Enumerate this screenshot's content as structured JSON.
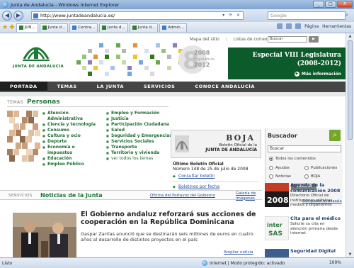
{
  "window": {
    "title": "Junta de Andalucía - Windows Internet Explorer",
    "buttons": {
      "minimize": "_",
      "maximize": "□",
      "close": "X"
    }
  },
  "browser": {
    "url": "http://www.juntadeandalucia.es/",
    "search_placeholder": "Google",
    "tabs": [
      "JUN...",
      "Junta d...",
      "Centra...",
      "Junta d...",
      "Junta d...",
      "Admin..."
    ],
    "tools": {
      "page": "Página",
      "tools": "Herramientas"
    }
  },
  "statusbar": {
    "left": "Listo",
    "zone": "Internet | Modo protegido: activado",
    "zoom": "100%"
  },
  "site": {
    "logo_text": "JUNTA DE ANDALUCIA",
    "toplinks": [
      "Mapa del sitio",
      "Listas de correo"
    ],
    "search_value": "Buscar",
    "banner": {
      "line1": "Especial VIII Legislatura",
      "line2": "(2008-2012)",
      "more": "Más información"
    },
    "legislatura_badge": {
      "year1": "2008",
      "word": "legislatura",
      "year2": "2012",
      "num": "8"
    },
    "nav": [
      "PORTADA",
      "TEMAS",
      "LA JUNTA",
      "SERVICIOS",
      "CONOCE ANDALUCÍA"
    ]
  },
  "temas": {
    "label": "TEMAS",
    "title": "Personas",
    "col1": [
      "Atención Administrativa",
      "Ciencia y tecnología",
      "Consumo",
      "Cultura y ocio",
      "Deporte",
      "Economía e impuestos",
      "Educación",
      "Empleo Público"
    ],
    "col2": [
      "Empleo y Formación",
      "Justicia",
      "Participación Ciudadana",
      "Salud",
      "Seguridad y Emergencias",
      "Servicios Sociales",
      "Transporte",
      "Territorio y vivienda",
      "ver todos los temas"
    ]
  },
  "boja": {
    "word": "BOJA",
    "sub1": "Boletín Oficial de la",
    "sub2": "JUNTA DE ANDALUCÍA",
    "last_title": "Último Boletín Oficial",
    "last_detail": "Número 148 de 25 de julio de 2008",
    "link1": "Consultar boletín",
    "link2": "Boletines por fecha"
  },
  "buscador": {
    "title": "Buscador",
    "input": "Buscar",
    "options": [
      "Todos los contenidos",
      "Ayudas",
      "Publicaciones",
      "Noticias",
      "BOJA"
    ],
    "button": "BUSCAR",
    "advanced": "Búsqueda avanzada"
  },
  "noticias": {
    "label": "SERVICIOS",
    "title": "Noticias de la Junta",
    "link1": "Oficina del Portavoz del Gobierno",
    "link2a": "Galería de",
    "link2b": "imágenes",
    "headline": "El Gobierno andaluz reforzará sus acciones de cooperación en la República Dominicana",
    "body": "Gaspar Zarrías anunció que se destinarán seis millones de euros en cuatro años al desarrollo de distintos proyectos en el país",
    "more": "Ampliar noticia"
  },
  "promos": [
    {
      "title": "Agenda de la comunicación 2008",
      "desc": "Directorio Oficial de instituciones públicas, medios y organismos",
      "badge": "2008"
    },
    {
      "title": "Cita para el médico",
      "desc": "Solicite su cita en atención primaria desde internet.",
      "badge": "inter SAS"
    },
    {
      "title": "Seguridad Digital",
      "desc": "",
      "badge": ""
    }
  ],
  "colors": {
    "brand_green": "#1f7a37",
    "banner_green": "#0c5c2b",
    "nav_dark": "#454545"
  }
}
